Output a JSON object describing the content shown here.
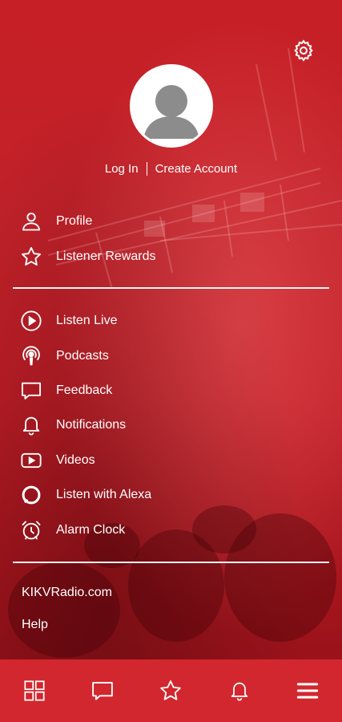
{
  "settings": {
    "icon": "gear-icon"
  },
  "profile": {
    "avatar_icon": "user-avatar-icon",
    "login_label": "Log In",
    "create_account_label": "Create Account"
  },
  "account_menu": [
    {
      "label": "Profile",
      "icon": "person-icon"
    },
    {
      "label": "Listener Rewards",
      "icon": "star-icon"
    }
  ],
  "main_menu": [
    {
      "label": "Listen Live",
      "icon": "play-circle-icon"
    },
    {
      "label": "Podcasts",
      "icon": "podcast-icon"
    },
    {
      "label": "Feedback",
      "icon": "chat-icon"
    },
    {
      "label": "Notifications",
      "icon": "bell-icon"
    },
    {
      "label": "Videos",
      "icon": "video-icon"
    },
    {
      "label": "Listen with Alexa",
      "icon": "alexa-icon"
    },
    {
      "label": "Alarm Clock",
      "icon": "alarm-clock-icon"
    }
  ],
  "links": {
    "website": "KIKVRadio.com",
    "help": "Help"
  },
  "bottom_nav": [
    {
      "icon": "grid-icon"
    },
    {
      "icon": "chat-icon"
    },
    {
      "icon": "star-icon"
    },
    {
      "icon": "bell-icon"
    },
    {
      "icon": "menu-icon"
    }
  ],
  "colors": {
    "background": "#c41f27",
    "bottom_bar": "#d2272e",
    "text": "#ffffff"
  }
}
